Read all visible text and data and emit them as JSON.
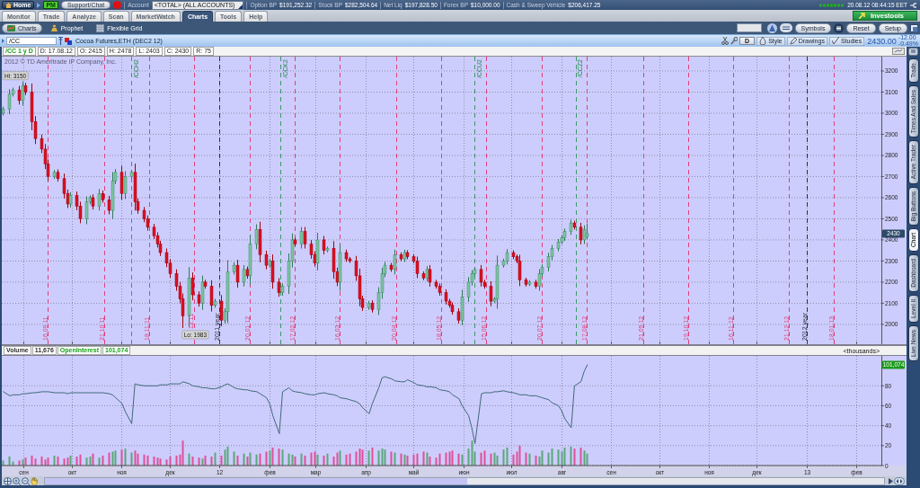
{
  "top_bar": {
    "home": "Home",
    "pm": "PM",
    "support": "Support/Chat",
    "account_label": "Account",
    "account": "<TOTAL> (ALL ACCOUNTS)",
    "balances": [
      {
        "label": "Option BP",
        "value": "$191,252.32"
      },
      {
        "label": "Stock BP",
        "value": "$282,504.64"
      },
      {
        "label": "Net Liq",
        "value": "$197,828.50"
      },
      {
        "label": "Forex BP",
        "value": "$10,000.00"
      },
      {
        "label": "Cash & Sweep Vehicle",
        "value": "$206,417.25"
      }
    ],
    "datetime": "20.08.12 08:44:15 EET"
  },
  "main_tabs": [
    {
      "label": "Monitor",
      "selected": false
    },
    {
      "label": "Trade",
      "selected": false
    },
    {
      "label": "Analyze",
      "selected": false
    },
    {
      "label": "Scan",
      "selected": false
    },
    {
      "label": "MarketWatch",
      "selected": false
    },
    {
      "label": "Charts",
      "selected": true
    },
    {
      "label": "Tools",
      "selected": false
    },
    {
      "label": "Help",
      "selected": false
    }
  ],
  "investools": "Investools",
  "sub_tabs": [
    {
      "label": "Charts",
      "selected": true
    },
    {
      "label": "Prophet",
      "selected": false
    },
    {
      "label": "Flexible Grid",
      "selected": false
    }
  ],
  "chart_tools": [
    "Symbols",
    "Reset",
    "Setup"
  ],
  "symbol_bar": {
    "symbol": "/CC",
    "description": "Cocoa Futures,ETH (DEC2 12)",
    "period": "D",
    "menus": [
      "Style",
      "Drawings",
      "Studies"
    ],
    "last": "2430.00",
    "change": "-12.00",
    "change_percent": "-0.49%"
  },
  "info_bar": {
    "title": "/CC 1 y D",
    "fields": [
      "D: 17.08.12",
      "O: 2415",
      "H: 2478",
      "L: 2403",
      "C: 2430",
      "R: 75"
    ]
  },
  "price_panel": {
    "copyright": "2012 © TD Ameritrade IP Company, Inc.",
    "high_label": "Hi: 3150",
    "low_label": "Lo: 1983",
    "last_badge": "2430",
    "chart_data": {
      "type": "candlestick",
      "grid": true,
      "x": [
        "2011-08-19",
        "2011-08-23",
        "2011-08-25",
        "2011-08-29",
        "2011-08-31",
        "2011-09-02",
        "2011-09-06",
        "2011-09-08",
        "2011-09-12",
        "2011-09-14",
        "2011-09-16",
        "2011-09-20",
        "2011-09-22",
        "2011-09-26",
        "2011-09-28",
        "2011-09-30",
        "2011-10-04",
        "2011-10-06",
        "2011-10-10",
        "2011-10-12",
        "2011-10-14",
        "2011-10-18",
        "2011-10-20",
        "2011-10-24",
        "2011-10-26",
        "2011-10-28",
        "2011-11-01",
        "2011-11-03",
        "2011-11-07",
        "2011-11-09",
        "2011-11-11",
        "2011-11-15",
        "2011-11-17",
        "2011-11-21",
        "2011-11-23",
        "2011-11-25",
        "2011-11-29",
        "2011-12-01",
        "2011-12-05",
        "2011-12-07",
        "2011-12-09",
        "2011-12-13",
        "2011-12-15",
        "2011-12-19",
        "2011-12-21",
        "2011-12-23",
        "2011-12-27",
        "2011-12-29",
        "2012-01-02",
        "2012-01-04",
        "2012-01-06",
        "2012-01-10",
        "2012-01-12",
        "2012-01-16",
        "2012-01-18",
        "2012-01-20",
        "2012-01-24",
        "2012-01-26",
        "2012-01-30",
        "2012-02-01",
        "2012-02-03",
        "2012-02-07",
        "2012-02-09",
        "2012-02-13",
        "2012-02-15",
        "2012-02-17",
        "2012-02-21",
        "2012-02-23",
        "2012-02-27",
        "2012-02-29",
        "2012-03-02",
        "2012-03-06",
        "2012-03-08",
        "2012-03-12",
        "2012-03-14",
        "2012-03-16",
        "2012-03-20",
        "2012-03-22",
        "2012-03-26",
        "2012-03-28",
        "2012-03-30",
        "2012-04-03",
        "2012-04-05",
        "2012-04-09",
        "2012-04-11",
        "2012-04-13",
        "2012-04-17",
        "2012-04-19",
        "2012-04-23",
        "2012-04-25",
        "2012-04-27",
        "2012-05-01",
        "2012-05-03",
        "2012-05-07",
        "2012-05-09",
        "2012-05-11",
        "2012-05-15",
        "2012-05-17",
        "2012-05-21",
        "2012-05-23",
        "2012-05-25",
        "2012-05-29",
        "2012-05-31",
        "2012-06-04",
        "2012-06-06",
        "2012-06-08",
        "2012-06-12",
        "2012-06-14",
        "2012-06-18",
        "2012-06-20",
        "2012-06-22",
        "2012-06-26",
        "2012-06-28",
        "2012-07-02",
        "2012-07-04",
        "2012-07-06",
        "2012-07-10",
        "2012-07-12",
        "2012-07-16",
        "2012-07-18",
        "2012-07-20",
        "2012-07-24",
        "2012-07-26",
        "2012-07-30",
        "2012-08-01",
        "2012-08-03",
        "2012-08-07",
        "2012-08-09",
        "2012-08-13",
        "2012-08-15",
        "2012-08-17"
      ],
      "ohlc": [
        [
          3000,
          3031,
          2989,
          3020
        ],
        [
          3020,
          3114,
          2996,
          3090
        ],
        [
          3090,
          3121,
          3079,
          3110
        ],
        [
          3110,
          3129,
          3041,
          3060
        ],
        [
          3060,
          3150,
          3036,
          3130
        ],
        [
          3130,
          3144,
          3086,
          3100
        ],
        [
          3100,
          3141,
          2919,
          2960
        ],
        [
          2960,
          2986,
          2854,
          2880
        ],
        [
          2880,
          2899,
          2811,
          2830
        ],
        [
          2830,
          2854,
          2736,
          2760
        ],
        [
          2760,
          2781,
          2679,
          2700
        ],
        [
          2700,
          2731,
          2689,
          2720
        ],
        [
          2720,
          2734,
          2676,
          2690
        ],
        [
          2690,
          2714,
          2596,
          2620
        ],
        [
          2620,
          2639,
          2551,
          2570
        ],
        [
          2570,
          2626,
          2554,
          2610
        ],
        [
          2610,
          2629,
          2541,
          2560
        ],
        [
          2560,
          2581,
          2479,
          2500
        ],
        [
          2500,
          2606,
          2474,
          2580
        ],
        [
          2580,
          2611,
          2569,
          2600
        ],
        [
          2600,
          2616,
          2544,
          2560
        ],
        [
          2560,
          2641,
          2539,
          2620
        ],
        [
          2620,
          2634,
          2576,
          2590
        ],
        [
          2590,
          2609,
          2521,
          2540
        ],
        [
          2540,
          2721,
          2499,
          2680
        ],
        [
          2680,
          2736,
          2664,
          2720
        ],
        [
          2720,
          2751,
          2589,
          2620
        ],
        [
          2620,
          2726,
          2594,
          2700
        ],
        [
          2700,
          2731,
          2689,
          2720
        ],
        [
          2720,
          2761,
          2539,
          2580
        ],
        [
          2580,
          2596,
          2524,
          2540
        ],
        [
          2540,
          2556,
          2484,
          2500
        ],
        [
          2500,
          2516,
          2444,
          2460
        ],
        [
          2460,
          2476,
          2404,
          2420
        ],
        [
          2420,
          2436,
          2364,
          2380
        ],
        [
          2380,
          2396,
          2324,
          2340
        ],
        [
          2340,
          2359,
          2271,
          2290
        ],
        [
          2290,
          2309,
          2221,
          2240
        ],
        [
          2240,
          2261,
          2159,
          2180
        ],
        [
          2180,
          2201,
          2099,
          2120
        ],
        [
          2120,
          2146,
          1983,
          2040
        ],
        [
          2040,
          2271,
          1989,
          2220
        ],
        [
          2220,
          2246,
          2114,
          2140
        ],
        [
          2140,
          2156,
          2084,
          2100
        ],
        [
          2100,
          2231,
          2069,
          2200
        ],
        [
          2200,
          2211,
          2169,
          2180
        ],
        [
          2180,
          2209,
          2061,
          2090
        ],
        [
          2090,
          2121,
          2079,
          2110
        ],
        [
          2110,
          2139,
          1991,
          2020
        ],
        [
          2020,
          2076,
          2004,
          2060
        ],
        [
          2060,
          2304,
          2006,
          2250
        ],
        [
          2250,
          2294,
          2236,
          2280
        ],
        [
          2280,
          2306,
          2174,
          2200
        ],
        [
          2200,
          2281,
          2179,
          2260
        ],
        [
          2260,
          2274,
          2216,
          2230
        ],
        [
          2230,
          2424,
          2186,
          2380
        ],
        [
          2380,
          2474,
          2356,
          2450
        ],
        [
          2450,
          2486,
          2294,
          2330
        ],
        [
          2330,
          2349,
          2261,
          2280
        ],
        [
          2280,
          2311,
          2269,
          2300
        ],
        [
          2300,
          2331,
          2169,
          2200
        ],
        [
          2200,
          2219,
          2131,
          2150
        ],
        [
          2150,
          2194,
          2136,
          2180
        ],
        [
          2180,
          2336,
          2144,
          2300
        ],
        [
          2300,
          2431,
          2269,
          2400
        ],
        [
          2400,
          2411,
          2369,
          2380
        ],
        [
          2380,
          2461,
          2359,
          2440
        ],
        [
          2440,
          2461,
          2359,
          2380
        ],
        [
          2380,
          2399,
          2311,
          2330
        ],
        [
          2330,
          2346,
          2274,
          2290
        ],
        [
          2290,
          2434,
          2256,
          2400
        ],
        [
          2400,
          2419,
          2331,
          2350
        ],
        [
          2350,
          2369,
          2341,
          2360
        ],
        [
          2360,
          2394,
          2216,
          2250
        ],
        [
          2250,
          2269,
          2181,
          2200
        ],
        [
          2200,
          2381,
          2159,
          2340
        ],
        [
          2340,
          2354,
          2296,
          2310
        ],
        [
          2310,
          2319,
          2291,
          2300
        ],
        [
          2300,
          2324,
          2206,
          2230
        ],
        [
          2230,
          2264,
          2086,
          2120
        ],
        [
          2120,
          2136,
          2064,
          2080
        ],
        [
          2080,
          2111,
          2069,
          2100
        ],
        [
          2100,
          2114,
          2056,
          2070
        ],
        [
          2070,
          2176,
          2044,
          2150
        ],
        [
          2150,
          2269,
          2121,
          2240
        ],
        [
          2240,
          2296,
          2224,
          2280
        ],
        [
          2280,
          2291,
          2249,
          2260
        ],
        [
          2260,
          2354,
          2236,
          2330
        ],
        [
          2330,
          2341,
          2299,
          2310
        ],
        [
          2310,
          2354,
          2296,
          2340
        ],
        [
          2340,
          2351,
          2309,
          2320
        ],
        [
          2320,
          2331,
          2289,
          2300
        ],
        [
          2300,
          2321,
          2219,
          2240
        ],
        [
          2240,
          2251,
          2209,
          2220
        ],
        [
          2220,
          2276,
          2204,
          2260
        ],
        [
          2260,
          2281,
          2179,
          2200
        ],
        [
          2200,
          2211,
          2169,
          2180
        ],
        [
          2180,
          2194,
          2136,
          2150
        ],
        [
          2150,
          2166,
          2094,
          2110
        ],
        [
          2110,
          2121,
          2079,
          2090
        ],
        [
          2090,
          2104,
          2046,
          2060
        ],
        [
          2060,
          2076,
          2004,
          2020
        ],
        [
          2020,
          2164,
          1996,
          2130
        ],
        [
          2130,
          2224,
          2106,
          2200
        ],
        [
          2200,
          2256,
          2184,
          2240
        ],
        [
          2240,
          2271,
          2229,
          2260
        ],
        [
          2260,
          2281,
          2179,
          2200
        ],
        [
          2200,
          2211,
          2169,
          2180
        ],
        [
          2180,
          2204,
          2086,
          2110
        ],
        [
          2110,
          2129,
          2101,
          2120
        ],
        [
          2120,
          2326,
          2074,
          2280
        ],
        [
          2280,
          2311,
          2269,
          2300
        ],
        [
          2300,
          2356,
          2284,
          2340
        ],
        [
          2340,
          2351,
          2309,
          2320
        ],
        [
          2320,
          2331,
          2289,
          2300
        ],
        [
          2300,
          2329,
          2181,
          2210
        ],
        [
          2210,
          2221,
          2179,
          2190
        ],
        [
          2190,
          2209,
          2181,
          2200
        ],
        [
          2200,
          2211,
          2169,
          2180
        ],
        [
          2180,
          2261,
          2159,
          2240
        ],
        [
          2240,
          2284,
          2226,
          2270
        ],
        [
          2270,
          2339,
          2251,
          2320
        ],
        [
          2320,
          2376,
          2304,
          2360
        ],
        [
          2360,
          2404,
          2346,
          2390
        ],
        [
          2390,
          2421,
          2379,
          2410
        ],
        [
          2410,
          2454,
          2396,
          2440
        ],
        [
          2440,
          2496,
          2424,
          2480
        ],
        [
          2480,
          2491,
          2449,
          2460
        ],
        [
          2460,
          2481,
          2379,
          2400
        ],
        [
          2400,
          2469,
          2381,
          2450
        ],
        [
          2415,
          2478,
          2403,
          2430
        ]
      ],
      "xlim": [
        "2011-08-18",
        "2013-03-04"
      ],
      "ylim": [
        1906,
        3268
      ],
      "yticks": [
        2000,
        2100,
        2200,
        2300,
        2400,
        2500,
        2600,
        2700,
        2800,
        2900,
        3000,
        3100,
        3200
      ],
      "ref_lines": [
        {
          "axis": "x",
          "value": "2011-09-16",
          "label": "16.09.11",
          "color": "#e0407a"
        },
        {
          "axis": "x",
          "value": "2011-10-21",
          "label": "21.10.11",
          "color": "#e0407a"
        },
        {
          "axis": "x",
          "value": "2011-11-07",
          "color": "#3a9a64"
        },
        {
          "axis": "x",
          "value": "2011-11-18",
          "label": "18.11.11",
          "color": "#e0407a"
        },
        {
          "axis": "x",
          "value": "2011-12-16",
          "label": "12.11",
          "color": "#e0407a"
        },
        {
          "axis": "x",
          "value": "2012-01-01",
          "label": "2011 year",
          "color": "#303040"
        },
        {
          "axis": "x",
          "value": "2012-01-20",
          "label": "20.01.12",
          "color": "#e0407a"
        },
        {
          "axis": "x",
          "value": "2012-02-08",
          "color": "#3a9a64"
        },
        {
          "axis": "x",
          "value": "2012-02-17",
          "label": "17.02.12",
          "color": "#e0407a"
        },
        {
          "axis": "x",
          "value": "2012-03-16",
          "label": "16.03.12",
          "color": "#e0407a"
        },
        {
          "axis": "x",
          "value": "2012-04-20",
          "label": "20.04.12",
          "color": "#e0407a"
        },
        {
          "axis": "x",
          "value": "2012-05-18",
          "label": "18.05.12",
          "color": "#e0407a"
        },
        {
          "axis": "x",
          "value": "2012-06-08",
          "color": "#3a9a64"
        },
        {
          "axis": "x",
          "value": "2012-06-15",
          "label": "15.06.12",
          "color": "#e0407a"
        },
        {
          "axis": "x",
          "value": "2012-07-20",
          "label": "20.07.12",
          "color": "#e0407a"
        },
        {
          "axis": "x",
          "value": "2012-08-10",
          "color": "#3a9a64"
        },
        {
          "axis": "x",
          "value": "2012-08-17",
          "label": "17.08.12",
          "color": "#e0407a"
        },
        {
          "axis": "x",
          "value": "2012-09-21",
          "label": "21.09.12",
          "color": "#e0407a"
        },
        {
          "axis": "x",
          "value": "2012-10-19",
          "label": "19.10.12",
          "color": "#e0407a"
        },
        {
          "axis": "x",
          "value": "2012-11-16",
          "label": "16.11.12",
          "color": "#e0407a"
        },
        {
          "axis": "x",
          "value": "2012-12-21",
          "label": "21.12.12",
          "color": "#e0407a"
        },
        {
          "axis": "x",
          "value": "2013-01-01",
          "label": "2012 year",
          "color": "#303040"
        },
        {
          "axis": "x",
          "value": "2013-01-18",
          "label": "18.01.13",
          "color": "#e0407a"
        }
      ],
      "annotations": [
        {
          "x": "2011-11-07",
          "y": 3255,
          "text": "/CCH2"
        },
        {
          "x": "2012-02-08",
          "y": 3255,
          "text": "/CCK2"
        },
        {
          "x": "2012-06-08",
          "y": 3255,
          "text": "/CCU2"
        },
        {
          "x": "2012-08-10",
          "y": 3255,
          "text": "/CCZ2"
        }
      ]
    }
  },
  "lower_panel": {
    "legend": [
      {
        "value": "11,676",
        "color": "#333333"
      },
      {
        "value": "101,074",
        "color": "#18a018"
      }
    ],
    "units": "<thousands>",
    "last_badge": "101,074",
    "chart_data": {
      "type": "bar",
      "grid": true,
      "x": [
        "2011-08-19",
        "2011-08-23",
        "2011-08-25",
        "2011-08-29",
        "2011-08-31",
        "2011-09-02",
        "2011-09-06",
        "2011-09-08",
        "2011-09-12",
        "2011-09-14",
        "2011-09-16",
        "2011-09-20",
        "2011-09-22",
        "2011-09-26",
        "2011-09-28",
        "2011-09-30",
        "2011-10-04",
        "2011-10-06",
        "2011-10-10",
        "2011-10-12",
        "2011-10-14",
        "2011-10-18",
        "2011-10-20",
        "2011-10-24",
        "2011-10-26",
        "2011-10-28",
        "2011-11-01",
        "2011-11-03",
        "2011-11-07",
        "2011-11-09",
        "2011-11-11",
        "2011-11-15",
        "2011-11-17",
        "2011-11-21",
        "2011-11-23",
        "2011-11-25",
        "2011-11-29",
        "2011-12-01",
        "2011-12-05",
        "2011-12-07",
        "2011-12-09",
        "2011-12-13",
        "2011-12-15",
        "2011-12-19",
        "2011-12-21",
        "2011-12-23",
        "2011-12-27",
        "2011-12-29",
        "2012-01-02",
        "2012-01-04",
        "2012-01-06",
        "2012-01-10",
        "2012-01-12",
        "2012-01-16",
        "2012-01-18",
        "2012-01-20",
        "2012-01-24",
        "2012-01-26",
        "2012-01-30",
        "2012-02-01",
        "2012-02-03",
        "2012-02-07",
        "2012-02-09",
        "2012-02-13",
        "2012-02-15",
        "2012-02-17",
        "2012-02-21",
        "2012-02-23",
        "2012-02-27",
        "2012-02-29",
        "2012-03-02",
        "2012-03-06",
        "2012-03-08",
        "2012-03-12",
        "2012-03-14",
        "2012-03-16",
        "2012-03-20",
        "2012-03-22",
        "2012-03-26",
        "2012-03-28",
        "2012-03-30",
        "2012-04-03",
        "2012-04-05",
        "2012-04-09",
        "2012-04-11",
        "2012-04-13",
        "2012-04-17",
        "2012-04-19",
        "2012-04-23",
        "2012-04-25",
        "2012-04-27",
        "2012-05-01",
        "2012-05-03",
        "2012-05-07",
        "2012-05-09",
        "2012-05-11",
        "2012-05-15",
        "2012-05-17",
        "2012-05-21",
        "2012-05-23",
        "2012-05-25",
        "2012-05-29",
        "2012-05-31",
        "2012-06-04",
        "2012-06-06",
        "2012-06-08",
        "2012-06-12",
        "2012-06-14",
        "2012-06-18",
        "2012-06-20",
        "2012-06-22",
        "2012-06-26",
        "2012-06-28",
        "2012-07-02",
        "2012-07-04",
        "2012-07-06",
        "2012-07-10",
        "2012-07-12",
        "2012-07-16",
        "2012-07-18",
        "2012-07-20",
        "2012-07-24",
        "2012-07-26",
        "2012-07-30",
        "2012-08-01",
        "2012-08-03",
        "2012-08-07",
        "2012-08-09",
        "2012-08-13",
        "2012-08-15",
        "2012-08-17"
      ],
      "series": [
        {
          "name": "Volume",
          "values": [
            5,
            9,
            4,
            5,
            6,
            8,
            10,
            7,
            9,
            6,
            8,
            10,
            9,
            7,
            8,
            10,
            9,
            11,
            8,
            9,
            12,
            8,
            10,
            13,
            14,
            15,
            16,
            17,
            13,
            15,
            12,
            11,
            10,
            9,
            8,
            7,
            6,
            9,
            10,
            11,
            25,
            12,
            9,
            8,
            7,
            10,
            9,
            13,
            10,
            16,
            19,
            14,
            10,
            12,
            9,
            13,
            11,
            12,
            14,
            15,
            18,
            17,
            16,
            12,
            11,
            9,
            12,
            10,
            13,
            14,
            11,
            10,
            12,
            9,
            13,
            15,
            11,
            12,
            14,
            17,
            16,
            15,
            18,
            15,
            17,
            16,
            14,
            13,
            12,
            11,
            10,
            11,
            12,
            14,
            13,
            9,
            8,
            12,
            13,
            14,
            15,
            12,
            11,
            17,
            25,
            14,
            13,
            15,
            12,
            13,
            10,
            16,
            18,
            11,
            14,
            20,
            13,
            12,
            10,
            9,
            15,
            13,
            17,
            16,
            14,
            18,
            19,
            17,
            18,
            15,
            12
          ],
          "colors": [
            "#5aa878",
            "#5aa878",
            "#5aa878",
            "#e0509a",
            "#5aa878",
            "#e0509a",
            "#e0509a",
            "#e0509a",
            "#e0509a",
            "#e0509a",
            "#e0509a",
            "#5aa878",
            "#e0509a",
            "#e0509a",
            "#e0509a",
            "#5aa878",
            "#e0509a",
            "#e0509a",
            "#5aa878",
            "#5aa878",
            "#e0509a",
            "#5aa878",
            "#e0509a",
            "#e0509a",
            "#5aa878",
            "#5aa878",
            "#e0509a",
            "#5aa878",
            "#5aa878",
            "#e0509a",
            "#e0509a",
            "#e0509a",
            "#e0509a",
            "#e0509a",
            "#e0509a",
            "#e0509a",
            "#e0509a",
            "#e0509a",
            "#e0509a",
            "#e0509a",
            "#e0509a",
            "#5aa878",
            "#e0509a",
            "#e0509a",
            "#5aa878",
            "#e0509a",
            "#e0509a",
            "#5aa878",
            "#e0509a",
            "#5aa878",
            "#5aa878",
            "#5aa878",
            "#e0509a",
            "#5aa878",
            "#e0509a",
            "#5aa878",
            "#5aa878",
            "#e0509a",
            "#e0509a",
            "#5aa878",
            "#e0509a",
            "#e0509a",
            "#5aa878",
            "#5aa878",
            "#5aa878",
            "#e0509a",
            "#5aa878",
            "#e0509a",
            "#e0509a",
            "#e0509a",
            "#5aa878",
            "#e0509a",
            "#5aa878",
            "#e0509a",
            "#e0509a",
            "#5aa878",
            "#e0509a",
            "#e0509a",
            "#e0509a",
            "#e0509a",
            "#e0509a",
            "#5aa878",
            "#e0509a",
            "#5aa878",
            "#5aa878",
            "#5aa878",
            "#e0509a",
            "#5aa878",
            "#e0509a",
            "#5aa878",
            "#e0509a",
            "#e0509a",
            "#e0509a",
            "#e0509a",
            "#5aa878",
            "#e0509a",
            "#e0509a",
            "#e0509a",
            "#e0509a",
            "#e0509a",
            "#e0509a",
            "#e0509a",
            "#5aa878",
            "#5aa878",
            "#5aa878",
            "#5aa878",
            "#e0509a",
            "#e0509a",
            "#e0509a",
            "#5aa878",
            "#5aa878",
            "#5aa878",
            "#5aa878",
            "#e0509a",
            "#e0509a",
            "#e0509a",
            "#e0509a",
            "#5aa878",
            "#e0509a",
            "#5aa878",
            "#5aa878",
            "#5aa878",
            "#5aa878",
            "#5aa878",
            "#5aa878",
            "#5aa878",
            "#5aa878",
            "#e0509a",
            "#e0509a",
            "#5aa878",
            "#5aa878"
          ]
        },
        {
          "name": "OpenInterest",
          "type": "line",
          "color": "#3e6a78",
          "values": [
            74,
            70,
            71,
            71,
            72,
            72,
            73,
            73,
            74,
            74,
            74,
            73,
            73,
            73,
            72,
            73,
            73,
            73,
            73,
            73,
            73,
            73,
            73,
            72,
            71,
            68,
            62,
            54,
            42,
            82,
            81,
            80,
            80,
            80,
            80,
            81,
            81,
            82,
            82,
            82,
            84,
            82,
            80,
            79,
            78,
            78,
            77,
            77,
            79,
            81,
            82,
            78,
            77,
            76,
            76,
            75,
            74,
            72,
            68,
            62,
            50,
            32,
            74,
            78,
            75,
            74,
            73,
            72,
            71,
            71,
            72,
            73,
            72,
            71,
            70,
            68,
            67,
            66,
            64,
            62,
            58,
            52,
            62,
            78,
            88,
            89,
            87,
            85,
            84,
            84,
            86,
            83,
            81,
            80,
            79,
            79,
            78,
            76,
            75,
            74,
            71,
            67,
            60,
            50,
            38,
            22,
            72,
            73,
            73,
            74,
            74,
            75,
            74,
            73,
            72,
            71,
            71,
            70,
            70,
            69,
            68,
            66,
            63,
            60,
            55,
            47,
            38,
            80,
            84,
            94,
            101
          ]
        }
      ],
      "xlim": [
        "2011-08-18",
        "2013-03-04"
      ],
      "ylim": [
        0,
        110
      ],
      "yticks": [
        0,
        20,
        40,
        60,
        80
      ],
      "xticks": [
        {
          "value": "2011-09-01",
          "label": "сен"
        },
        {
          "value": "2011-10-01",
          "label": "окт"
        },
        {
          "value": "2011-11-01",
          "label": "ноя"
        },
        {
          "value": "2011-12-01",
          "label": "дек"
        },
        {
          "value": "2012-01-01",
          "label": "12"
        },
        {
          "value": "2012-02-01",
          "label": "фев"
        },
        {
          "value": "2012-03-01",
          "label": "мар"
        },
        {
          "value": "2012-04-01",
          "label": "апр"
        },
        {
          "value": "2012-05-01",
          "label": "май"
        },
        {
          "value": "2012-06-01",
          "label": "июн"
        },
        {
          "value": "2012-07-01",
          "label": "июл"
        },
        {
          "value": "2012-08-01",
          "label": "авг"
        },
        {
          "value": "2012-09-01",
          "label": "сен"
        },
        {
          "value": "2012-10-01",
          "label": "окт"
        },
        {
          "value": "2012-11-01",
          "label": "ноя"
        },
        {
          "value": "2012-12-01",
          "label": "дек"
        },
        {
          "value": "2013-01-01",
          "label": "13"
        },
        {
          "value": "2013-02-01",
          "label": "фев"
        }
      ]
    }
  },
  "side_tabs": [
    {
      "label": "Trade",
      "selected": false
    },
    {
      "label": "Times And Sales",
      "selected": false
    },
    {
      "label": "Active Trader",
      "selected": false
    },
    {
      "label": "Big Buttons",
      "selected": false
    },
    {
      "label": "Chart",
      "selected": true
    },
    {
      "label": "Dashboard",
      "selected": false
    },
    {
      "label": "Level II",
      "selected": false
    },
    {
      "label": "Live News",
      "selected": false
    }
  ]
}
